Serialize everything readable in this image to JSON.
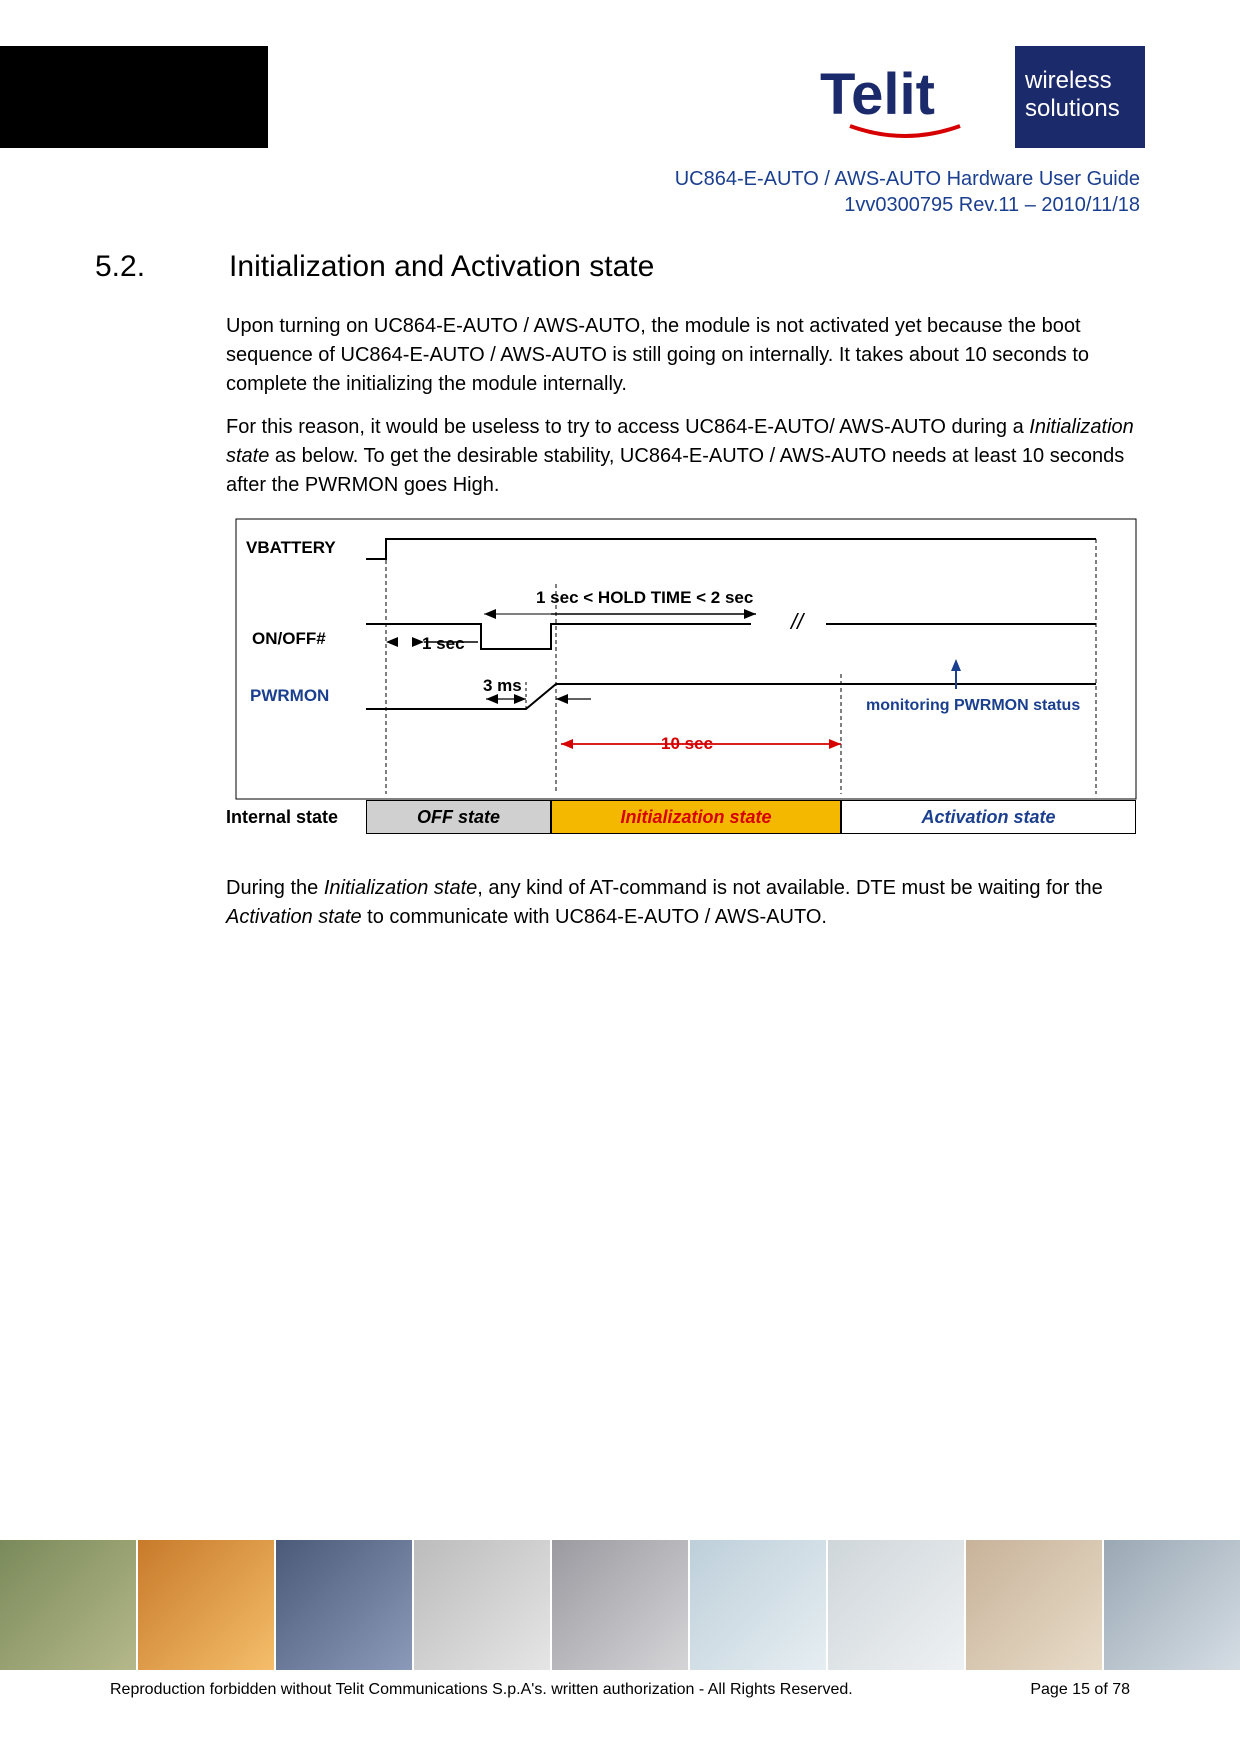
{
  "header": {
    "doc_title": "UC864-E-AUTO / AWS-AUTO Hardware User Guide",
    "doc_rev": "1vv0300795 Rev.11 – 2010/11/18",
    "logo_tagline1": "wireless",
    "logo_tagline2": "solutions",
    "brand": "Telit"
  },
  "section": {
    "num": "5.2.",
    "title": "Initialization and Activation state"
  },
  "body": {
    "p1": "Upon turning on UC864-E-AUTO / AWS-AUTO, the module is not activated yet because the boot sequence of UC864-E-AUTO / AWS-AUTO is still going on internally. It takes about 10 seconds to complete the initializing the module internally.",
    "p2a": "For this reason, it would be useless to try to access UC864-E-AUTO/ AWS-AUTO during a ",
    "p2i": "Initialization state",
    "p2b": " as below. To get the desirable stability, UC864-E-AUTO / AWS-AUTO needs at least 10 seconds after the PWRMON goes High.",
    "p3a": "During the ",
    "p3i1": "Initialization state",
    "p3b": ", any kind of AT-command is not available. DTE must be waiting for the ",
    "p3i2": "Activation state",
    "p3c": " to communicate with UC864-E-AUTO / AWS-AUTO."
  },
  "diagram": {
    "vbattery": "VBATTERY",
    "onoff": "ON/OFF#",
    "pwrmon": "PWRMON",
    "internal": "Internal state",
    "hold_time": "1 sec < HOLD TIME < 2 sec",
    "one_sec": "1 sec",
    "three_ms": "3 ms",
    "ten_sec": "10 sec",
    "monitor": "monitoring PWRMON status",
    "break": "//",
    "states": {
      "off": "OFF state",
      "init": "Initialization state",
      "act": "Activation  state"
    }
  },
  "footer": {
    "copyright": "Reproduction forbidden without Telit Communications S.p.A's. written authorization - All Rights Reserved.",
    "page": "Page 15 of 78"
  }
}
